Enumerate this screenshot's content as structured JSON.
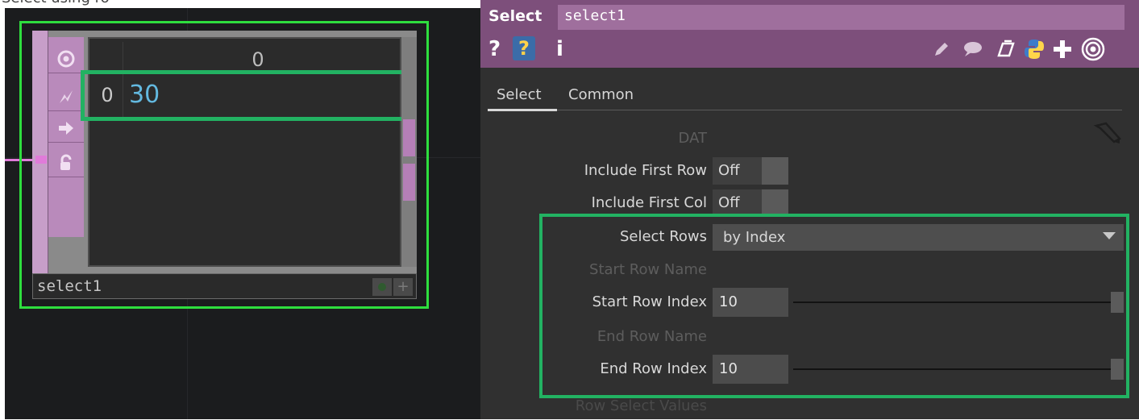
{
  "caption_fragment": "Select using ro",
  "network": {
    "node": {
      "name": "select1",
      "column_header": "0",
      "row_index": "0",
      "cell_value": "30",
      "icons": [
        "viewer-icon",
        "bypass-icon",
        "display-icon",
        "lock-icon"
      ]
    }
  },
  "params": {
    "op_type": "Select",
    "op_name": "select1",
    "header_icons": {
      "help": "?",
      "python_help": "?",
      "info": "i",
      "tools": [
        "pencil-icon",
        "comment-icon",
        "clone-icon",
        "python-icon",
        "plus-icon",
        "target-icon"
      ]
    },
    "tabs": [
      {
        "label": "Select"
      },
      {
        "label": "Common"
      }
    ],
    "dat_label": "DAT",
    "include_first_row": {
      "label": "Include First Row",
      "value": "Off"
    },
    "include_first_col": {
      "label": "Include First Col",
      "value": "Off"
    },
    "select_rows": {
      "label": "Select Rows",
      "value": "by Index"
    },
    "start_row_name": {
      "label": "Start Row Name"
    },
    "start_row_index": {
      "label": "Start Row Index",
      "value": "10"
    },
    "end_row_name": {
      "label": "End Row  Name"
    },
    "end_row_index": {
      "label": "End Row Index",
      "value": "10"
    },
    "row_select_values": {
      "label": "Row Select Values"
    }
  },
  "colors": {
    "highlight": "#22b262",
    "header_purple": "#7d4f7b",
    "node_green_border": "#2ede3e",
    "cell_value": "#63b9e0"
  }
}
